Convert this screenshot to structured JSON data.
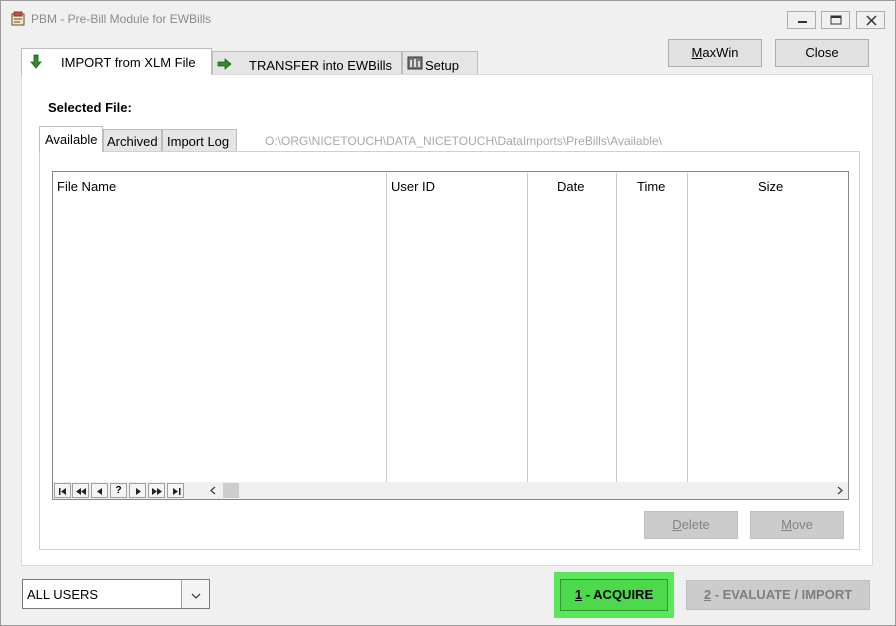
{
  "window": {
    "title": "PBM - Pre-Bill Module for EWBills"
  },
  "tabs": [
    {
      "label": "IMPORT from XLM File",
      "icon": "down-arrow-icon",
      "active": true
    },
    {
      "label": "TRANSFER into EWBills",
      "icon": "right-arrow-icon",
      "active": false
    },
    {
      "label": "Setup",
      "icon": "setup-icon",
      "active": false
    }
  ],
  "header_buttons": {
    "maxwin_mnemonic": "M",
    "maxwin_rest": "axWin",
    "close": "Close"
  },
  "selected_file_label": "Selected File:",
  "subtabs": [
    {
      "label": "Available",
      "active": true
    },
    {
      "label": "Archived",
      "active": false
    },
    {
      "label": "Import Log",
      "active": false
    }
  ],
  "path": "O:\\ORG\\NICETOUCH\\DATA_NICETOUCH\\DataImports\\PreBills\\Available\\",
  "grid": {
    "columns": [
      "File Name",
      "User ID",
      "Date",
      "Time",
      "Size"
    ],
    "rows": []
  },
  "navigation": {
    "buttons": [
      "first-icon",
      "prev-page-icon",
      "prev-icon",
      "help-icon",
      "next-icon",
      "next-page-icon",
      "last-icon"
    ],
    "help_glyph": "?"
  },
  "grid_actions": {
    "delete_mnemonic": "D",
    "delete_rest": "elete",
    "move_mnemonic": "M",
    "move_rest": "ove"
  },
  "user_filter": {
    "selected": "ALL USERS"
  },
  "actions": {
    "acquire_num": "1",
    "acquire_rest": " - ACQUIRE",
    "evaluate_num": "2",
    "evaluate_rest": " - EVALUATE / IMPORT"
  },
  "colors": {
    "acquire_highlight": "#5be65b",
    "disabled_gray": "#cccccc"
  }
}
